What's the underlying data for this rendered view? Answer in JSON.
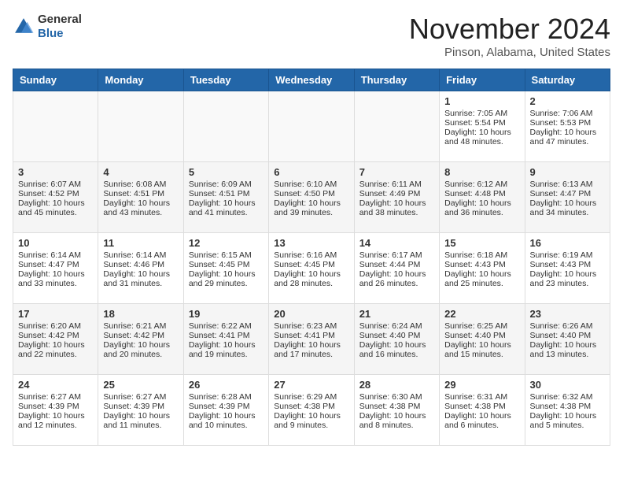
{
  "header": {
    "logo_line1": "General",
    "logo_line2": "Blue",
    "month": "November 2024",
    "location": "Pinson, Alabama, United States"
  },
  "weekdays": [
    "Sunday",
    "Monday",
    "Tuesday",
    "Wednesday",
    "Thursday",
    "Friday",
    "Saturday"
  ],
  "rows": [
    [
      {
        "day": "",
        "info": ""
      },
      {
        "day": "",
        "info": ""
      },
      {
        "day": "",
        "info": ""
      },
      {
        "day": "",
        "info": ""
      },
      {
        "day": "",
        "info": ""
      },
      {
        "day": "1",
        "info": "Sunrise: 7:05 AM\nSunset: 5:54 PM\nDaylight: 10 hours and 48 minutes."
      },
      {
        "day": "2",
        "info": "Sunrise: 7:06 AM\nSunset: 5:53 PM\nDaylight: 10 hours and 47 minutes."
      }
    ],
    [
      {
        "day": "3",
        "info": "Sunrise: 6:07 AM\nSunset: 4:52 PM\nDaylight: 10 hours and 45 minutes."
      },
      {
        "day": "4",
        "info": "Sunrise: 6:08 AM\nSunset: 4:51 PM\nDaylight: 10 hours and 43 minutes."
      },
      {
        "day": "5",
        "info": "Sunrise: 6:09 AM\nSunset: 4:51 PM\nDaylight: 10 hours and 41 minutes."
      },
      {
        "day": "6",
        "info": "Sunrise: 6:10 AM\nSunset: 4:50 PM\nDaylight: 10 hours and 39 minutes."
      },
      {
        "day": "7",
        "info": "Sunrise: 6:11 AM\nSunset: 4:49 PM\nDaylight: 10 hours and 38 minutes."
      },
      {
        "day": "8",
        "info": "Sunrise: 6:12 AM\nSunset: 4:48 PM\nDaylight: 10 hours and 36 minutes."
      },
      {
        "day": "9",
        "info": "Sunrise: 6:13 AM\nSunset: 4:47 PM\nDaylight: 10 hours and 34 minutes."
      }
    ],
    [
      {
        "day": "10",
        "info": "Sunrise: 6:14 AM\nSunset: 4:47 PM\nDaylight: 10 hours and 33 minutes."
      },
      {
        "day": "11",
        "info": "Sunrise: 6:14 AM\nSunset: 4:46 PM\nDaylight: 10 hours and 31 minutes."
      },
      {
        "day": "12",
        "info": "Sunrise: 6:15 AM\nSunset: 4:45 PM\nDaylight: 10 hours and 29 minutes."
      },
      {
        "day": "13",
        "info": "Sunrise: 6:16 AM\nSunset: 4:45 PM\nDaylight: 10 hours and 28 minutes."
      },
      {
        "day": "14",
        "info": "Sunrise: 6:17 AM\nSunset: 4:44 PM\nDaylight: 10 hours and 26 minutes."
      },
      {
        "day": "15",
        "info": "Sunrise: 6:18 AM\nSunset: 4:43 PM\nDaylight: 10 hours and 25 minutes."
      },
      {
        "day": "16",
        "info": "Sunrise: 6:19 AM\nSunset: 4:43 PM\nDaylight: 10 hours and 23 minutes."
      }
    ],
    [
      {
        "day": "17",
        "info": "Sunrise: 6:20 AM\nSunset: 4:42 PM\nDaylight: 10 hours and 22 minutes."
      },
      {
        "day": "18",
        "info": "Sunrise: 6:21 AM\nSunset: 4:42 PM\nDaylight: 10 hours and 20 minutes."
      },
      {
        "day": "19",
        "info": "Sunrise: 6:22 AM\nSunset: 4:41 PM\nDaylight: 10 hours and 19 minutes."
      },
      {
        "day": "20",
        "info": "Sunrise: 6:23 AM\nSunset: 4:41 PM\nDaylight: 10 hours and 17 minutes."
      },
      {
        "day": "21",
        "info": "Sunrise: 6:24 AM\nSunset: 4:40 PM\nDaylight: 10 hours and 16 minutes."
      },
      {
        "day": "22",
        "info": "Sunrise: 6:25 AM\nSunset: 4:40 PM\nDaylight: 10 hours and 15 minutes."
      },
      {
        "day": "23",
        "info": "Sunrise: 6:26 AM\nSunset: 4:40 PM\nDaylight: 10 hours and 13 minutes."
      }
    ],
    [
      {
        "day": "24",
        "info": "Sunrise: 6:27 AM\nSunset: 4:39 PM\nDaylight: 10 hours and 12 minutes."
      },
      {
        "day": "25",
        "info": "Sunrise: 6:27 AM\nSunset: 4:39 PM\nDaylight: 10 hours and 11 minutes."
      },
      {
        "day": "26",
        "info": "Sunrise: 6:28 AM\nSunset: 4:39 PM\nDaylight: 10 hours and 10 minutes."
      },
      {
        "day": "27",
        "info": "Sunrise: 6:29 AM\nSunset: 4:38 PM\nDaylight: 10 hours and 9 minutes."
      },
      {
        "day": "28",
        "info": "Sunrise: 6:30 AM\nSunset: 4:38 PM\nDaylight: 10 hours and 8 minutes."
      },
      {
        "day": "29",
        "info": "Sunrise: 6:31 AM\nSunset: 4:38 PM\nDaylight: 10 hours and 6 minutes."
      },
      {
        "day": "30",
        "info": "Sunrise: 6:32 AM\nSunset: 4:38 PM\nDaylight: 10 hours and 5 minutes."
      }
    ]
  ]
}
